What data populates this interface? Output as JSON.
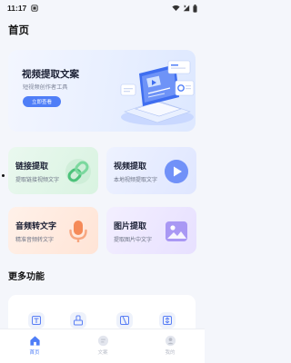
{
  "status_bar": {
    "time": "11:17"
  },
  "header": {
    "title": "首页"
  },
  "banner": {
    "title": "视频提取文案",
    "subtitle": "短视频创作者工具",
    "cta": "立即查看"
  },
  "features": [
    {
      "title": "链接提取",
      "subtitle": "提取链接视频文字",
      "icon": "link-icon"
    },
    {
      "title": "视频提取",
      "subtitle": "本地视频提取文字",
      "icon": "play-icon"
    },
    {
      "title": "音频转文字",
      "subtitle": "精准音频转文字",
      "icon": "microphone-icon"
    },
    {
      "title": "图片提取",
      "subtitle": "提取图片中文字",
      "icon": "image-icon"
    }
  ],
  "more": {
    "title": "更多功能",
    "items": [
      "text-doc-icon",
      "extract-icon",
      "video-crop-icon",
      "compress-icon"
    ]
  },
  "tabs": [
    {
      "label": "首页",
      "icon": "home-icon",
      "active": true
    },
    {
      "label": "文案",
      "icon": "document-icon",
      "active": false
    },
    {
      "label": "我的",
      "icon": "profile-icon",
      "active": false
    }
  ],
  "colors": {
    "accent": "#4f7ef7",
    "link_card": "#dff5e6",
    "video_card": "#e4eaff",
    "audio_card": "#ffe8dc",
    "image_card": "#ebe5ff"
  }
}
